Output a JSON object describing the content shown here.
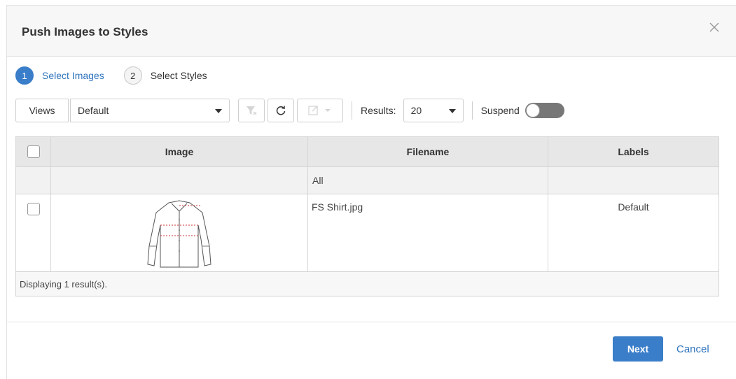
{
  "dialog": {
    "title": "Push Images to Styles"
  },
  "steps": [
    {
      "number": "1",
      "label": "Select Images",
      "active": true
    },
    {
      "number": "2",
      "label": "Select Styles",
      "active": false
    }
  ],
  "toolbar": {
    "views_label": "Views",
    "view_selected": "Default",
    "results_label": "Results:",
    "results_selected": "20",
    "suspend_label": "Suspend",
    "suspend_on": false
  },
  "grid": {
    "columns": [
      "Image",
      "Filename",
      "Labels"
    ],
    "filter": {
      "filename": "All"
    },
    "rows": [
      {
        "filename": "FS Shirt.jpg",
        "labels": "Default",
        "image_icon": "shirt-thumbnail"
      }
    ],
    "status": "Displaying 1 result(s)."
  },
  "footer": {
    "next_label": "Next",
    "cancel_label": "Cancel"
  },
  "colors": {
    "accent": "#3a7dc9",
    "link": "#2f73bd"
  }
}
